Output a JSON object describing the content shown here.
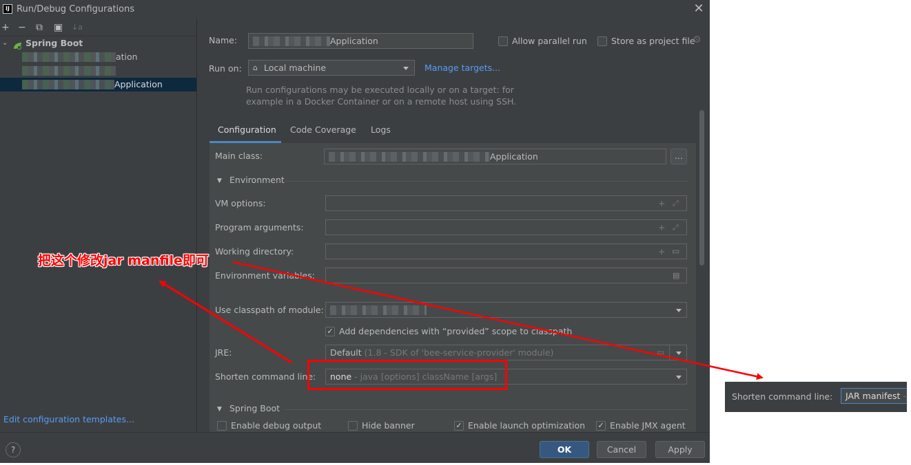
{
  "window": {
    "title": "Run/Debug Configurations",
    "logo_text": "IJ"
  },
  "left_panel": {
    "toolbar": [
      "+",
      "−",
      "⧉",
      "▣",
      "↓a"
    ],
    "tree": {
      "group_label": "Spring Boot",
      "items": [
        {
          "label_suffix": "ation"
        },
        {
          "label_suffix": ""
        },
        {
          "label_suffix": "Application"
        }
      ]
    },
    "edit_templates_link": "Edit configuration templates..."
  },
  "header": {
    "name_label": "Name:",
    "name_value": "Application",
    "allow_parallel_label": "Allow parallel run",
    "store_project_label": "Store as project file",
    "run_on_label": "Run on:",
    "run_on_value": "Local machine",
    "manage_targets": "Manage targets...",
    "hint_line1": "Run configurations may be executed locally or on a target: for",
    "hint_line2": "example in a Docker Container or on a remote host using SSH."
  },
  "tabs": [
    "Configuration",
    "Code Coverage",
    "Logs"
  ],
  "config": {
    "main_class_label": "Main class:",
    "main_class_value": "Application",
    "browse_label": "...",
    "environment_section": "Environment",
    "vm_options_label": "VM options:",
    "program_args_label": "Program arguments:",
    "working_dir_label": "Working directory:",
    "env_vars_label": "Environment variables:",
    "classpath_label": "Use classpath of module:",
    "add_deps_label": "Add dependencies with “provided” scope to classpath",
    "jre_label": "JRE:",
    "jre_value": "Default",
    "jre_hint": "(1.8 - SDK of 'bee-service-provider' module)",
    "shorten_label": "Shorten command line:",
    "shorten_value": "none",
    "shorten_hint": "- java [options] className [args]",
    "spring_boot_section": "Spring Boot",
    "debug_output_label": "Enable debug output",
    "hide_banner_label": "Hide banner",
    "launch_opt_label": "Enable launch optimization",
    "jmx_label": "Enable JMX agent"
  },
  "buttons": {
    "ok": "OK",
    "cancel": "Cancel",
    "apply": "Apply",
    "help": "?"
  },
  "annotation": {
    "text": "把这个修改jar manfile即可"
  },
  "inset": {
    "label": "Shorten command line:",
    "value": "JAR manifest",
    "hint": "-"
  },
  "colors": {
    "dialog_bg": "#3c3f41",
    "field_bg": "#45494a",
    "selection": "#0d293e",
    "link": "#589df6",
    "accent_tab": "#4a88c7",
    "annotation": "#ff0000"
  }
}
